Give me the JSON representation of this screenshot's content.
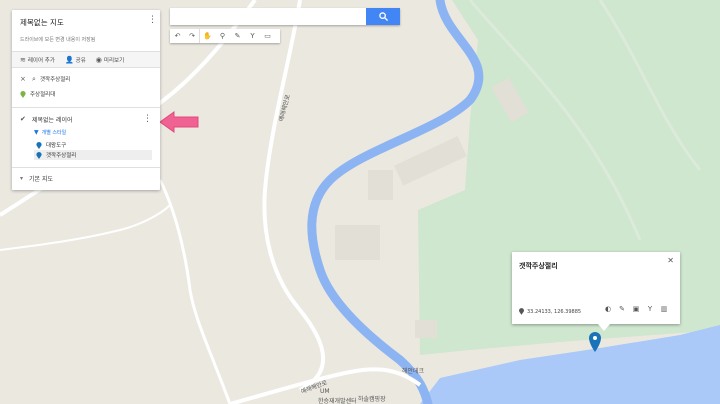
{
  "panel": {
    "title": "제목없는 지도",
    "subtitle": "드라이브에 모든 변경 내용이 저장됨",
    "actions": [
      {
        "label": "레이어 추가",
        "icon": "layers-icon"
      },
      {
        "label": "공유",
        "icon": "add-person-icon"
      },
      {
        "label": "미리보기",
        "icon": "eye-icon"
      }
    ],
    "search_result": "갯깍주상절리",
    "search_item": "주상절리대",
    "layer_title": "제목없는 레이어",
    "layer_style": "개별 스타일",
    "layer_items": [
      "대왕도구",
      "갯깍주상절리"
    ],
    "basemap": "기본 지도"
  },
  "search": {
    "value": ""
  },
  "info": {
    "title": "갯깍주상절리",
    "coords": "33.24133, 126.39885"
  },
  "map_labels": {
    "road_a": "예래해안로",
    "road_b": "예래해안로",
    "place_a": "해안데크",
    "place_b": "하솔캠핑장",
    "place_c": "UM",
    "place_d": "한승재개발센터"
  },
  "colors": {
    "water": "#aac8f8",
    "river": "#8db4f2",
    "land": "#ebe8e0",
    "park": "#cfe6cf",
    "accent": "#4285f4",
    "arrow": "#f06292",
    "marker": "#1a73b8"
  }
}
